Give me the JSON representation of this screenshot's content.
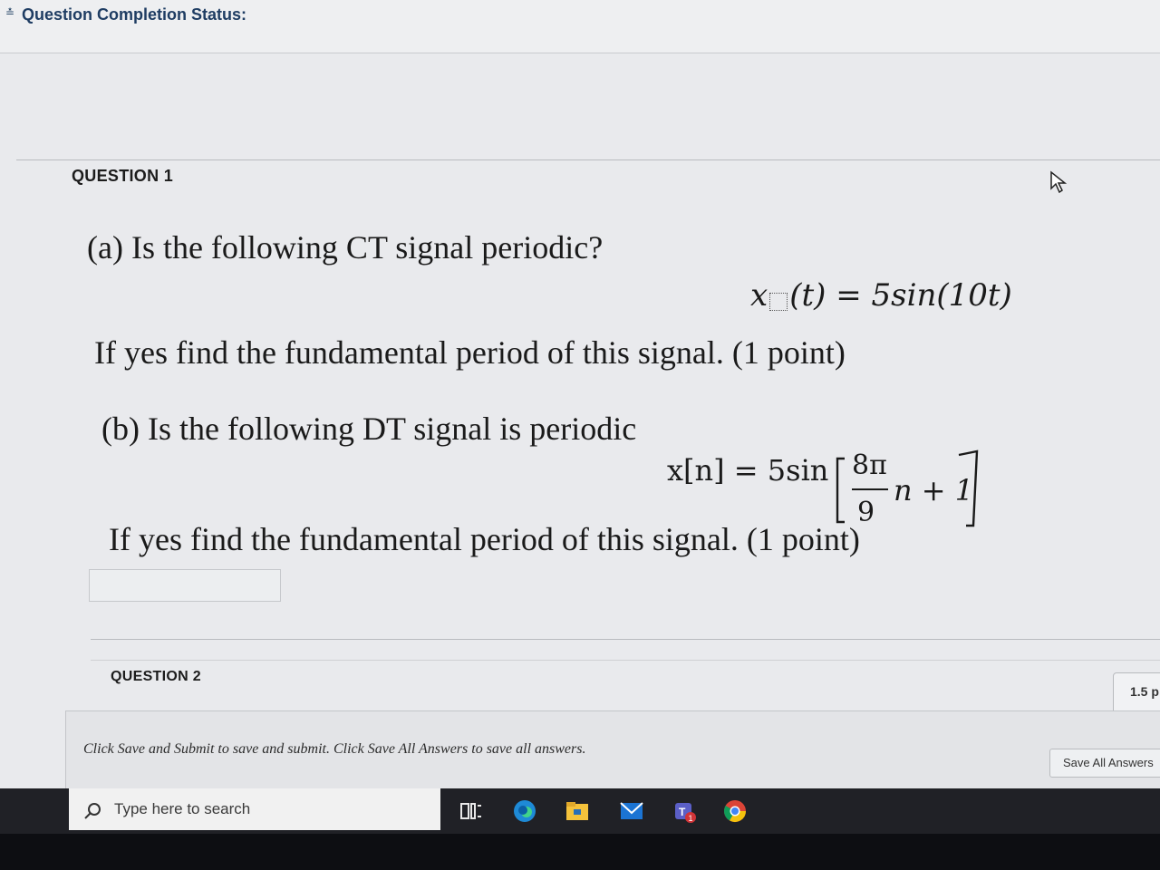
{
  "header": {
    "status_label": "Question Completion Status:"
  },
  "question1": {
    "title": "QUESTION 1",
    "part_a": "(a) Is the following CT signal periodic?",
    "eq_a_lhs": "x",
    "eq_a_rest": "(t) = 5sin(10t)",
    "part_a_followup": "If yes find the fundamental period of this signal. (1 point)",
    "part_b": "(b) Is the following DT signal is periodic",
    "eq_b_lhs": "x[n] = 5sin",
    "eq_b_num": "8π",
    "eq_b_den": "9",
    "eq_b_tail": "n + 1",
    "part_b_followup": "If yes find the fundamental period of this signal. (1 point)"
  },
  "question2": {
    "title": "QUESTION 2",
    "points": "1.5 p"
  },
  "footer": {
    "instructions": "Click Save and Submit to save and submit. Click Save All Answers to save all answers.",
    "save_all_label": "Save All Answers"
  },
  "taskbar": {
    "search_placeholder": "Type here to search",
    "icons": [
      "task-view-icon",
      "edge-icon",
      "file-explorer-icon",
      "mail-icon",
      "teams-icon",
      "chrome-icon"
    ],
    "teams_badge": "1"
  }
}
